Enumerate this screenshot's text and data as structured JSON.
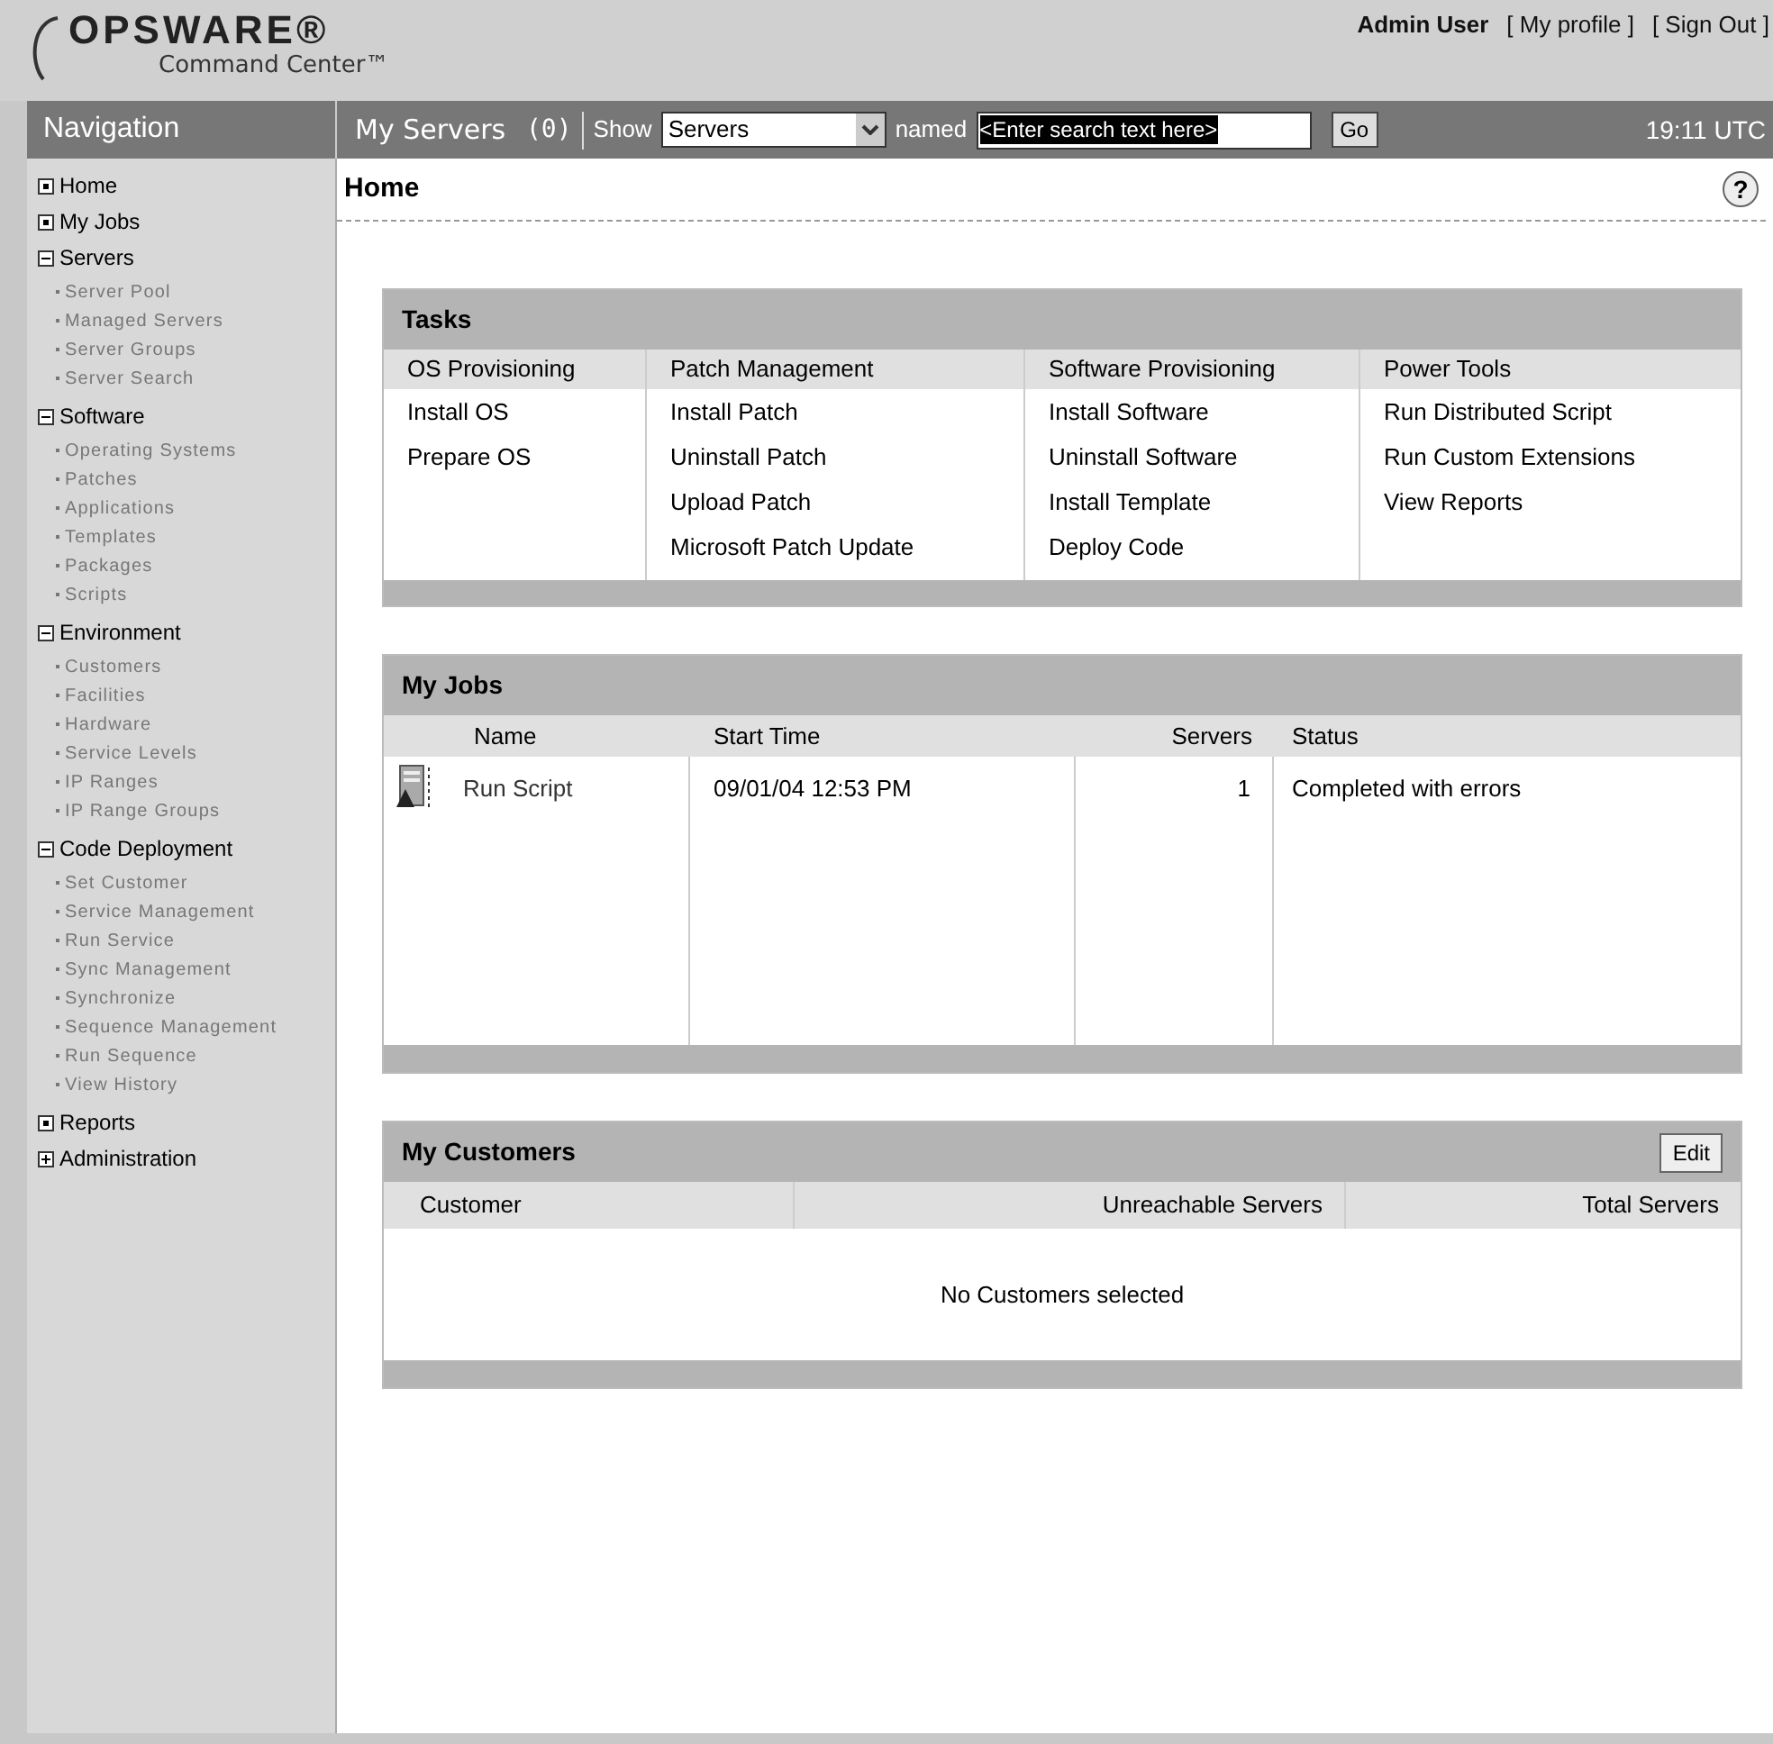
{
  "header": {
    "logo": "OPSWARE®",
    "logo_subtitle": "Command Center™",
    "user": "Admin User",
    "links": [
      "[ My profile ]",
      "[ Sign Out ]"
    ]
  },
  "toolbar": {
    "nav_title": "Navigation",
    "section": "My Servers",
    "count": "(0)",
    "show_label": "Show",
    "show_select": "Servers",
    "named_label": "named",
    "search": {
      "value": "<Enter search text here>"
    },
    "go": "Go",
    "time": "19:11 UTC"
  },
  "sidebar": {
    "items": [
      {
        "label": "Home",
        "kind": "link"
      },
      {
        "label": "My Jobs",
        "kind": "link"
      },
      {
        "label": "Servers",
        "kind": "group",
        "expanded": true,
        "children": [
          "Server Pool",
          "Managed Servers",
          "Server Groups",
          "Server Search"
        ]
      },
      {
        "label": "Software",
        "kind": "group",
        "expanded": true,
        "children": [
          "Operating Systems",
          "Patches",
          "Applications",
          "Templates",
          "Packages",
          "Scripts"
        ]
      },
      {
        "label": "Environment",
        "kind": "group",
        "expanded": true,
        "children": [
          "Customers",
          "Facilities",
          "Hardware",
          "Service Levels",
          "IP Ranges",
          "IP Range Groups"
        ]
      },
      {
        "label": "Code Deployment",
        "kind": "group",
        "expanded": true,
        "children": [
          "Set Customer",
          "Service Management",
          "Run Service",
          "Sync Management",
          "Synchronize",
          "Sequence Management",
          "Run Sequence",
          "View History"
        ]
      },
      {
        "label": "Reports",
        "kind": "link"
      },
      {
        "label": "Administration",
        "kind": "group",
        "expanded": false
      }
    ]
  },
  "page": {
    "title": "Home",
    "help": "?"
  },
  "tasks": {
    "title": "Tasks",
    "columns": [
      {
        "heading": "OS Provisioning",
        "links": [
          "Install OS",
          "Prepare OS"
        ]
      },
      {
        "heading": "Patch Management",
        "links": [
          "Install Patch",
          "Uninstall Patch",
          "Upload Patch",
          "Microsoft Patch Update"
        ]
      },
      {
        "heading": "Software Provisioning",
        "links": [
          "Install Software",
          "Uninstall Software",
          "Install Template",
          "Deploy Code"
        ]
      },
      {
        "heading": "Power Tools",
        "links": [
          "Run Distributed Script",
          "Run Custom Extensions",
          "View Reports"
        ]
      }
    ]
  },
  "jobs": {
    "title": "My Jobs",
    "columns": [
      "Name",
      "Start Time",
      "Servers",
      "Status"
    ],
    "rows": [
      {
        "name": "Run Script",
        "start": "09/01/04 12:53 PM",
        "servers": "1",
        "status": "Completed with errors"
      }
    ]
  },
  "customers": {
    "title": "My Customers",
    "edit": "Edit",
    "columns": [
      "Customer",
      "Unreachable Servers",
      "Total Servers"
    ],
    "empty": "No Customers selected"
  }
}
